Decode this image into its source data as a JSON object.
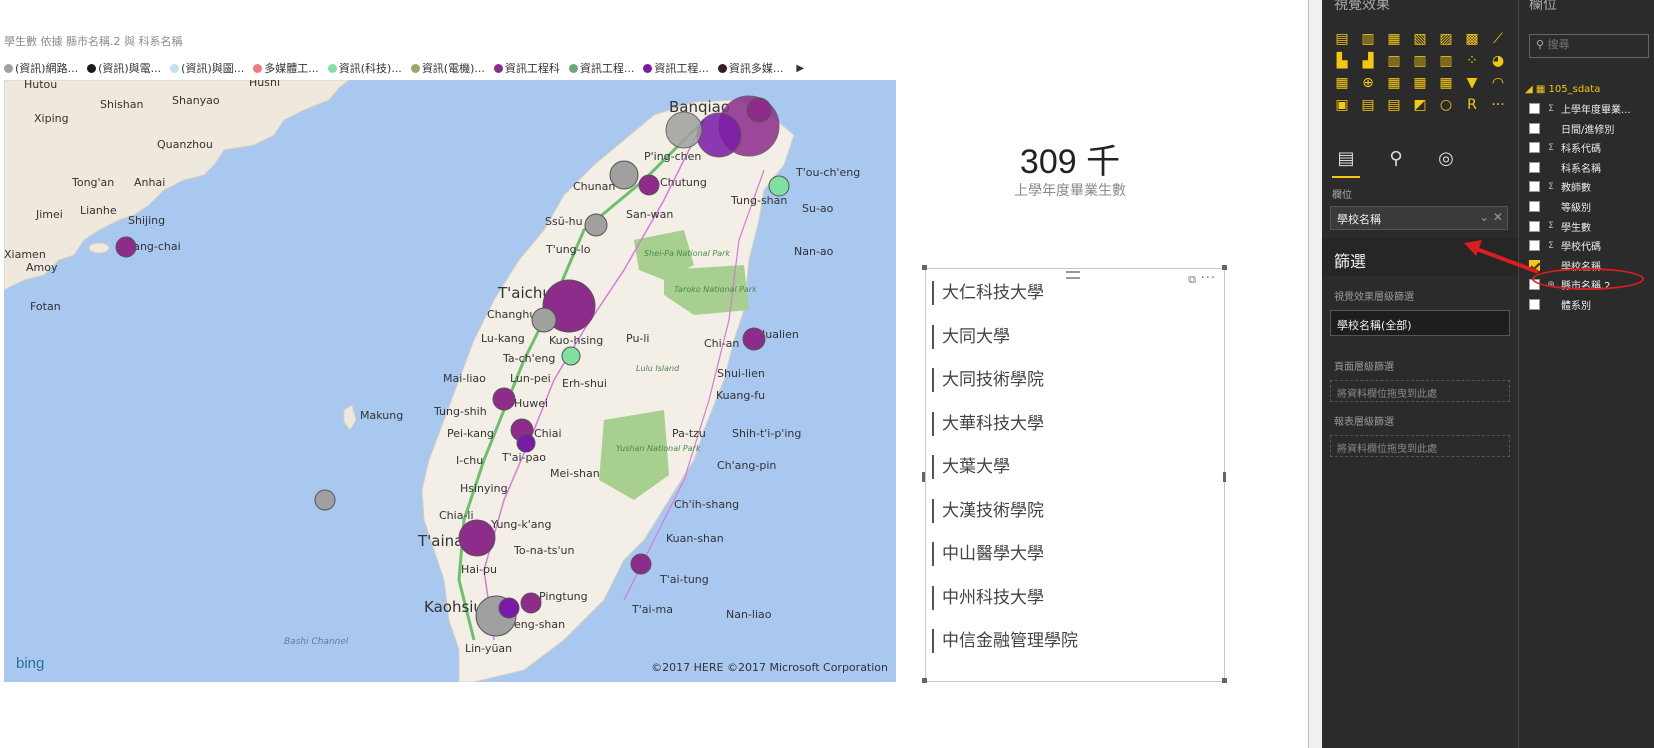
{
  "map": {
    "title": "學生數 依據 縣市名稱.2 與 科系名稱",
    "legend": [
      {
        "label": "(資訊)網路...",
        "color": "#a0a0a0"
      },
      {
        "label": "(資訊)與電...",
        "color": "#1a1a1a"
      },
      {
        "label": "(資訊)與圖...",
        "color": "#bfe3f0"
      },
      {
        "label": "多媒體工...",
        "color": "#f27a7a"
      },
      {
        "label": "資訊(科技)...",
        "color": "#7fe0a0"
      },
      {
        "label": "資訊(電機)...",
        "color": "#9aa86a"
      },
      {
        "label": "資訊工程科",
        "color": "#8e2c8c"
      },
      {
        "label": "資訊工程...",
        "color": "#6aa87a"
      },
      {
        "label": "資訊工程...",
        "color": "#7a1aa8"
      },
      {
        "label": "資訊多媒...",
        "color": "#3a1a2a"
      }
    ],
    "legend_next": "▶",
    "places": {
      "hutou": "Hutou",
      "husni": "Husni",
      "xiping": "Xiping",
      "shishan": "Shishan",
      "shanyao": "Shanyao",
      "quanzhou": "Quanzhou",
      "tongan": "Tong'an",
      "anhai": "Anhai",
      "jimei": "Jimei",
      "lianhe": "Lianhe",
      "shijing": "Shijing",
      "xiamen": "Xiamen",
      "amoy": "Amoy",
      "yangchai": "Yang-chai",
      "fotan": "Fotan",
      "makung": "Makung",
      "banqiao": "Banqiao",
      "pingchen": "P'ing-chen",
      "chunan": "Chunan",
      "chutung": "Chutung",
      "touchen": "T'ou-ch'eng",
      "tungshan": "Tung-shan",
      "suao": "Su-ao",
      "ssuhu": "Ssŭ-hu",
      "sanwan": "San-wan",
      "tunglo": "T'ung-lo",
      "nanao": "Nan-ao",
      "taichung": "T'aichung",
      "changhua": "Changhua",
      "lukang": "Lu-kang",
      "kuohsing": "Kuo-hsing",
      "puli": "Pu-li",
      "chian": "Chi-an",
      "hualien": "Hualien",
      "tacheng": "Ta-ch'eng",
      "mailiao": "Mai-liao",
      "lunpei": "Lun-pei",
      "erhshui": "Erh-shui",
      "shuilien": "Shui-lien",
      "huwei": "Huwei",
      "kuangfu": "Kuang-fu",
      "tungshih": "Tung-shih",
      "peikang": "Pei-kang",
      "chiai": "Chiai",
      "patzu": "Pa-tzu",
      "shihtiping": "Shih-t'i-p'ing",
      "ichu": "I-chu",
      "taipao": "T'ai-pao",
      "meishan": "Mei-shan",
      "changpin": "Ch'ang-pin",
      "hsinying": "Hsinying",
      "chiali": "Chia-li",
      "chihshang": "Ch'ih-shang",
      "yungkang": "Yung-k'ang",
      "tainan": "T'ainan",
      "tonatsun": "To-na-ts'un",
      "kuanshan": "Kuan-shan",
      "haipu": "Hai-pu",
      "taitung": "T'ai-tung",
      "pingtung": "Pingtung",
      "kaohsiung": "Kaohsiung",
      "taima": "T'ai-ma",
      "nanliao": "Nan-liao",
      "fengshan": "eng-shan",
      "linyuan": "Lin-yüan",
      "sheipa": "Shei-Pa National Park",
      "taroko": "Taroko National Park",
      "lulu": "Lulu Island",
      "yushan": "Yushan National Park",
      "bashi": "Bashi Channel"
    },
    "bing": "bing",
    "copyright": "©2017 HERE   ©2017 Microsoft Corporation"
  },
  "card": {
    "value": "309 千",
    "label": "上學年度畢業生數"
  },
  "slicer": {
    "focus_icon": "⧉",
    "more": "···",
    "items": [
      "大仁科技大學",
      "大同大學",
      "大同技術學院",
      "大華科技大學",
      "大葉大學",
      "大漢技術學院",
      "中山醫學大學",
      "中州科技大學",
      "中信金融管理學院"
    ]
  },
  "viz_pane": {
    "title": "視覺效果",
    "icons": [
      "▤",
      "▥",
      "▦",
      "▧",
      "▨",
      "▩",
      "⟋",
      "▙",
      "▟",
      "▥",
      "▥",
      "▥",
      "⁘",
      "◕",
      "▦",
      "⊕",
      "▦",
      "▦",
      "▦",
      "▼",
      "◠",
      "▣",
      "▤",
      "▤",
      "◩",
      "○",
      "R",
      "···"
    ],
    "tabs": [
      "fields-tab",
      "format-tab",
      "analytics-tab"
    ],
    "tab_glyphs": [
      "▤",
      "⚲",
      "◎"
    ],
    "fields_label": "欄位",
    "field_well_value": "學校名稱",
    "field_well_ctrl": "⌄ ✕",
    "filters_title": "篩選",
    "visual_filter_label": "視覺效果層級篩選",
    "visual_filter_chip": "學校名稱(全部)",
    "page_filter_label": "頁面層級篩選",
    "page_drop": "將資料欄位拖曳到此處",
    "report_filter_label": "報表層級篩選",
    "report_drop": "將資料欄位拖曳到此處"
  },
  "fields_pane": {
    "title": "欄位",
    "search_placeholder": "搜尋",
    "table_name": "105_sdata",
    "fields": [
      {
        "type": "Σ",
        "label": "上學年度畢業...",
        "checked": false
      },
      {
        "type": "",
        "label": "日間/進修別",
        "checked": false
      },
      {
        "type": "Σ",
        "label": "科系代碼",
        "checked": false
      },
      {
        "type": "",
        "label": "科系名稱",
        "checked": false
      },
      {
        "type": "Σ",
        "label": "教師數",
        "checked": false
      },
      {
        "type": "",
        "label": "等級別",
        "checked": false
      },
      {
        "type": "Σ",
        "label": "學生數",
        "checked": false
      },
      {
        "type": "Σ",
        "label": "學校代碼",
        "checked": false
      },
      {
        "type": "",
        "label": "學校名稱",
        "checked": true
      },
      {
        "type": "⊕",
        "label": "縣市名稱.2",
        "checked": false
      },
      {
        "type": "",
        "label": "體系別",
        "checked": false
      }
    ]
  },
  "accent_color": "#f2c811",
  "annotation_color": "#d81e1e"
}
